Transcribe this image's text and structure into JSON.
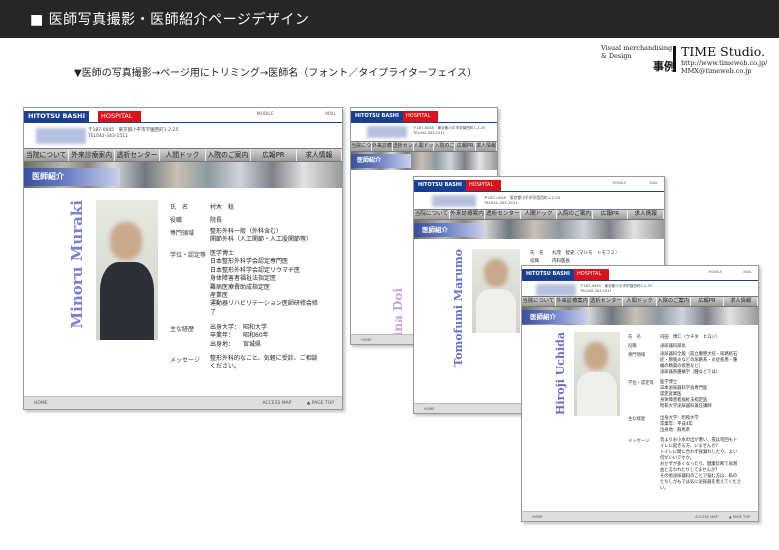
{
  "header": {
    "title": "■ 医師写真撮影・医師紹介ページデザイン"
  },
  "brand": {
    "tagline_line1": "Visual merchandising",
    "tagline_line2": "& Design",
    "case_label": "事例",
    "studio": "TIME Studio.",
    "url": "http://www.timeweb.co.jp/",
    "email": "MMX@timeweb.co.jp"
  },
  "caption": "▼医師の写真撮影→ページ用にトリミング→医師名（フォント／タイプライターフェイス）",
  "site": {
    "logo_main": "HITOTSU BASHI",
    "logo_sub": "HOSPITAL",
    "icon_mobile": "MOBILE",
    "icon_mail": "MAIL",
    "address_line1": "〒187-0045　東京都小平市学園西町1-2-25",
    "address_line2": "TEL042-343-1511",
    "nav": [
      "当院について",
      "外来診療案内",
      "透析センター",
      "人間ドック",
      "入院のご案内",
      "広報PR",
      "求人情報"
    ],
    "section_title": "医師紹介",
    "footer_home": "HOME",
    "footer_access": "ACCESS MAP",
    "footer_top": "▲ PAGE TOP"
  },
  "doctors": {
    "muraki": {
      "roman": "Minoru Muraki",
      "labels": [
        "氏　名",
        "役職",
        "専門領域",
        "学位・認定等",
        "主な経歴",
        "メッセージ"
      ],
      "name": "村木　稔",
      "position": "院長",
      "specialty": [
        "整形外科一般（外科含む）",
        "関節外科（人工関節・人工股関節等）"
      ],
      "degrees": [
        "医学博士",
        "日本整形外科学会認定専門医",
        "日本整形外科学会認定リウマチ医",
        "身体障害者福祉法指定医",
        "難病医療費助成指定医",
        "産業医",
        "運動器リハビリテーション医師研修会修",
        "了"
      ],
      "career": [
        "出身大学：　昭和大学",
        "卒業年：　　昭和60年",
        "出身地：　　宮城県"
      ],
      "message": [
        "整形外科的なこと、気軽に受診、ご相談",
        "ください。"
      ]
    },
    "doi": {
      "roman": "Fumina Doi"
    },
    "marumo": {
      "roman": "Tomofumi Marumo",
      "labels": [
        "氏　名",
        "役職"
      ],
      "name": "丸茂　智史（マルモ　トモフミ）",
      "position": "内科医長"
    },
    "uchida": {
      "roman": "Hiroji Uchida",
      "labels": [
        "氏　名",
        "役職",
        "専門領域",
        "学位・認定等",
        "主な経歴",
        "メッセージ"
      ],
      "name": "内田　博仁（ウチダ　ヒロジ）",
      "position": "泌尿器科部長",
      "specialty": [
        "泌尿器科全般（前立腺肥大症・尿路結石",
        "症・膀胱炎などの尿路系・炎症疾患・腫",
        "瘍の精巣の疾患など）",
        "泌尿器系腫瘍学（腫などでは）"
      ],
      "degrees": [
        "医学博士",
        "日本泌尿器科学会専門医",
        "認定産業医",
        "身体障害者福祉法指定医",
        "昭和大学泌尿器科兼任講師"
      ],
      "career": [
        "出身大学：昭和大学",
        "卒業年：平成4年",
        "出身地：群馬県"
      ],
      "message": [
        "昔よりお小水の出が悪い、夜は何回もト",
        "イレに起きる方、いませんか？",
        "トイレに間に合わず尿漏れしたり、よい",
        "何がいいですか。",
        "おかずが多くなったり、健康診断で尿潜",
        "血と言われたりしてませんか？",
        "その他泌尿器科のことで悩む方は、私の",
        "たちしがもでは気に泌尿器を患えてくださ",
        "い。"
      ]
    }
  }
}
